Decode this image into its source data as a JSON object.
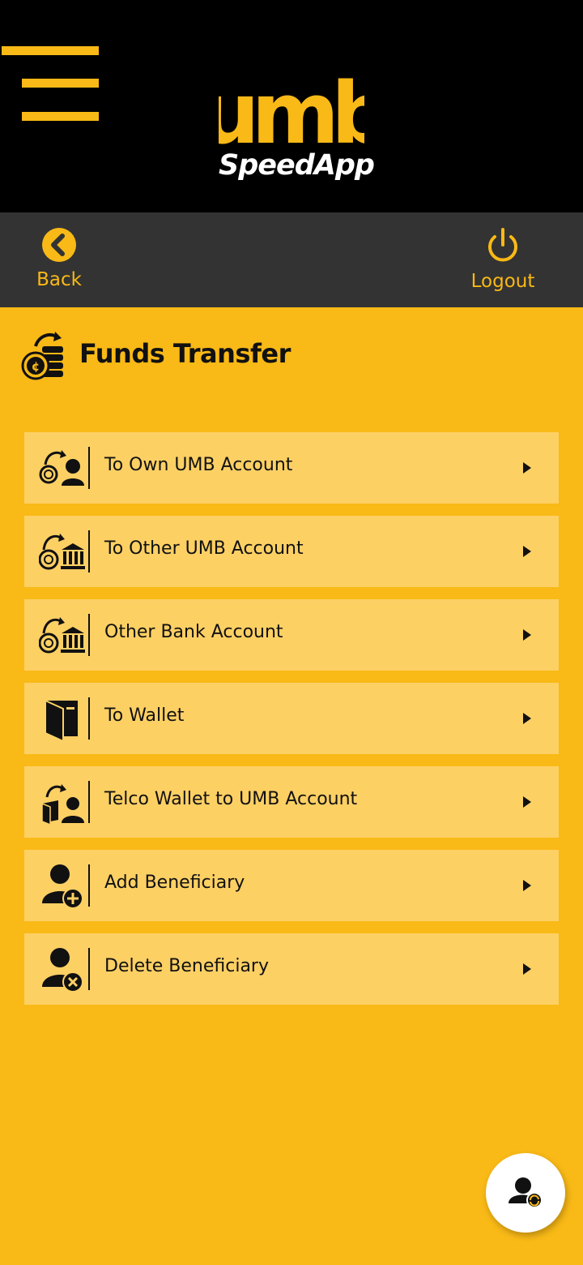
{
  "header": {
    "logo_main": "umb",
    "logo_sub": "SpeedApp",
    "brand_color": "#f9b916"
  },
  "nav": {
    "back_label": "Back",
    "logout_label": "Logout"
  },
  "page": {
    "title": "Funds Transfer"
  },
  "items": [
    {
      "label": "To Own UMB Account",
      "icon": "coin-to-person-icon"
    },
    {
      "label": "To Other UMB Account",
      "icon": "coin-to-bank-icon"
    },
    {
      "label": "Other Bank Account",
      "icon": "coin-to-bank-icon"
    },
    {
      "label": "To Wallet",
      "icon": "wallet-icon"
    },
    {
      "label": "Telco Wallet to UMB Account",
      "icon": "wallet-to-person-icon"
    },
    {
      "label": "Add Beneficiary",
      "icon": "add-user-icon"
    },
    {
      "label": "Delete Beneficiary",
      "icon": "remove-user-icon"
    }
  ],
  "fab": {
    "icon": "user-sync-icon"
  }
}
